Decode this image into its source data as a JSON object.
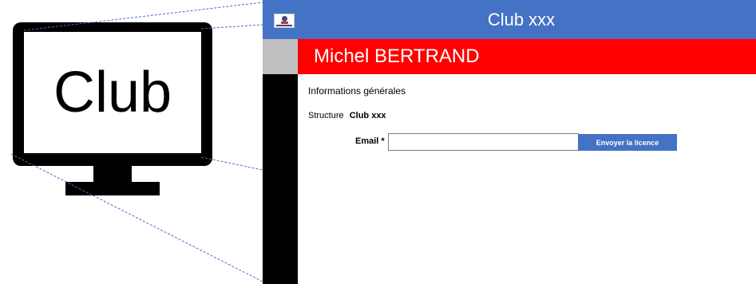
{
  "illustration": {
    "monitor_label": "Club"
  },
  "header": {
    "title": "Club xxx",
    "logo_icon": "club-logo-icon",
    "background": "#4472c4"
  },
  "member": {
    "name": "Michel BERTRAND",
    "banner_color": "#ff0000"
  },
  "section": {
    "title": "Informations générales"
  },
  "structure": {
    "label": "Structure",
    "value": "Club xxx"
  },
  "email": {
    "label": "Email *",
    "value": "",
    "placeholder": ""
  },
  "actions": {
    "send_license_label": "Envoyer la licence"
  }
}
